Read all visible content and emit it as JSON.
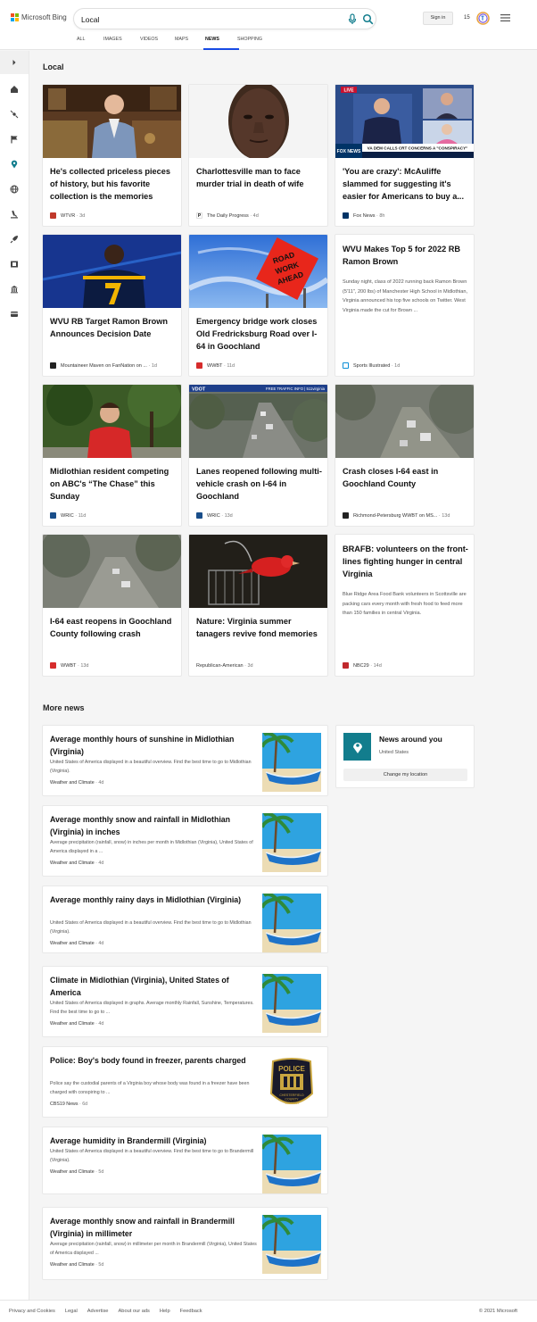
{
  "header": {
    "brand": "Microsoft Bing",
    "logo_colors": [
      "#f25022",
      "#7fba00",
      "#00a4ef",
      "#ffb900"
    ],
    "search_value": "Local",
    "mic_icon": "microphone-icon",
    "search_icon": "search-icon",
    "signin_label": "Sign in",
    "rewards_count": "15",
    "menu_icon": "hamburger-icon",
    "tabs": [
      {
        "label": "ALL"
      },
      {
        "label": "IMAGES"
      },
      {
        "label": "VIDEOS"
      },
      {
        "label": "MAPS"
      },
      {
        "label": "NEWS",
        "active": true
      },
      {
        "label": "SHOPPING"
      }
    ],
    "accent": "#174ae4"
  },
  "sidebar": {
    "icons": [
      "expand-chevron-icon",
      "home-icon",
      "satellite-icon",
      "flag-icon",
      "location-pin-icon",
      "globe-icon",
      "microscope-icon",
      "rocket-icon",
      "film-icon",
      "bank-icon",
      "credit-card-icon"
    ]
  },
  "local": {
    "heading": "Local",
    "cards": [
      {
        "title": "He's collected priceless pieces of history, but his favorite collection is the memories",
        "source": "WTVR",
        "age": "· 3d",
        "fav_color": "#c0392b"
      },
      {
        "title": "Charlottesville man to face murder trial in death of wife",
        "source": "The Daily Progress",
        "age": "· 4d",
        "fav_color": "#ffffff"
      },
      {
        "title": "'You are crazy': McAuliffe slammed for suggesting it's easier for Americans to buy a...",
        "source": "Fox News",
        "age": "· 8h",
        "fav_color": "#003366"
      },
      {
        "title": "WVU RB Target Ramon Brown Announces Decision Date",
        "source": "Mountaineer Maven on FanNation on ...",
        "age": "· 1d",
        "fav_color": "#222222"
      },
      {
        "title": "Emergency bridge work closes Old Fredricksburg Road over I-64 in Goochland",
        "source": "WWBT",
        "age": "· 11d",
        "fav_color": "#d62c2c"
      },
      {
        "title": "WVU Makes Top 5 for 2022 RB Ramon Brown",
        "snippet": "Sunday night, class of 2022 running back Ramon Brown (5'11\", 200 lbs) of Manchester High School in Midlothian, Virginia announced his top five schools on Twitter. West Virginia made the cut for Brown ...",
        "source": "Sports Illustrated",
        "age": "· 1d",
        "fav_color": "#0b8ed6"
      },
      {
        "title": "Midlothian resident competing on ABC's “The Chase” this Sunday",
        "source": "WRIC",
        "age": "· 11d",
        "fav_color": "#1a4e8a"
      },
      {
        "title": "Lanes reopened following multi-vehicle crash on I-64 in Goochland",
        "source": "WRIC",
        "age": "· 13d",
        "fav_color": "#1a4e8a"
      },
      {
        "title": "Crash closes I-64 east in Goochland County",
        "source": "Richmond-Petersburg WWBT on MS...",
        "age": "· 13d",
        "fav_color": "#222222"
      },
      {
        "title": "I-64 east reopens in Goochland County following crash",
        "source": "WWBT",
        "age": "· 13d",
        "fav_color": "#d62c2c"
      },
      {
        "title": "Nature: Virginia summer tanagers revive fond memories",
        "source": "Republican-American",
        "age": "· 3d",
        "fav_color": ""
      },
      {
        "title": "BRAFB: volunteers on the front-lines fighting hunger in central Virginia",
        "snippet": "Blue Ridge Area Food Bank volunteers in Scottsville are packing cars every month with fresh food to feed more than 150 families in central Virginia.",
        "source": "NBC29",
        "age": "· 14d",
        "fav_color": "#c0282d"
      }
    ]
  },
  "more_news": {
    "heading": "More news",
    "items": [
      {
        "title": "Average monthly hours of sunshine in Midlothian (Virginia)",
        "snippet": "United States of America displayed in a beautiful overview. Find the best time to go to Midlothian (Virginia).",
        "source": "Weather and Climate",
        "age": "· 4d",
        "thumb": "beach-boat"
      },
      {
        "title": "Average monthly snow and rainfall in Midlothian (Virginia) in inches",
        "snippet": "Average precipitation (rainfall, snow) in inches per month in Midlothian (Virginia), United States of America displayed in a ...",
        "source": "Weather and Climate",
        "age": "· 4d",
        "thumb": "beach-boat"
      },
      {
        "title": "Average monthly rainy days in Midlothian (Virginia)",
        "snippet": "United States of America displayed in a beautiful overview. Find the best time to go to Midlothian (Virginia).",
        "source": "Weather and Climate",
        "age": "· 4d",
        "thumb": "beach-boat"
      },
      {
        "title": "Climate in Midlothian (Virginia), United States of America",
        "snippet": "United States of America displayed in graphs. Average monthly Rainfall, Sunshine, Temperatures. Find the best time to go to ...",
        "source": "Weather and Climate",
        "age": "· 4d",
        "thumb": "beach-boat"
      },
      {
        "title": "Police: Boy's body found in freezer, parents charged",
        "snippet": "Police say the custodial parents of a Virginia boy whose body was found in a freezer have been charged with conspiring to ...",
        "source": "CBS19 News",
        "age": "· 6d",
        "thumb": "police-badge"
      },
      {
        "title": "Average humidity in Brandermill (Virginia)",
        "snippet": "United States of America displayed in a beautiful overview. Find the best time to go to Brandermill (Virginia).",
        "source": "Weather and Climate",
        "age": "· 5d",
        "thumb": "beach-boat"
      },
      {
        "title": "Average monthly snow and rainfall in Brandermill (Virginia) in millimeter",
        "snippet": "Average precipitation (rainfall, snow) in millimeter per month in Brandermill (Virginia), United States of America displayed ...",
        "source": "Weather and Climate",
        "age": "· 5d",
        "thumb": "beach-boat"
      }
    ],
    "badge_lines": [
      "POLICE",
      "CHESTERFIELD",
      "COUNTY",
      "VIRGINIA"
    ]
  },
  "news_around_you": {
    "title": "News around you",
    "location": "United States",
    "button": "Change my location",
    "pin_icon": "location-pin-icon"
  },
  "images": {
    "road_sign": [
      "ROAD",
      "WORK",
      "AHEAD"
    ],
    "tv_banner": "VA DEM CALLS CRT CONCERNS A \"CONSPIRACY\"",
    "tv_live": "LIVE",
    "tv_network": "FOX NEWS",
    "cam_banner": "FREE TRAFFIC INFO | 511virginia",
    "cam_logo": "VDOT"
  },
  "footer": {
    "links": [
      "Privacy and Cookies",
      "Legal",
      "Advertise",
      "About our ads",
      "Help",
      "Feedback"
    ],
    "copyright": "© 2021 Microsoft"
  }
}
